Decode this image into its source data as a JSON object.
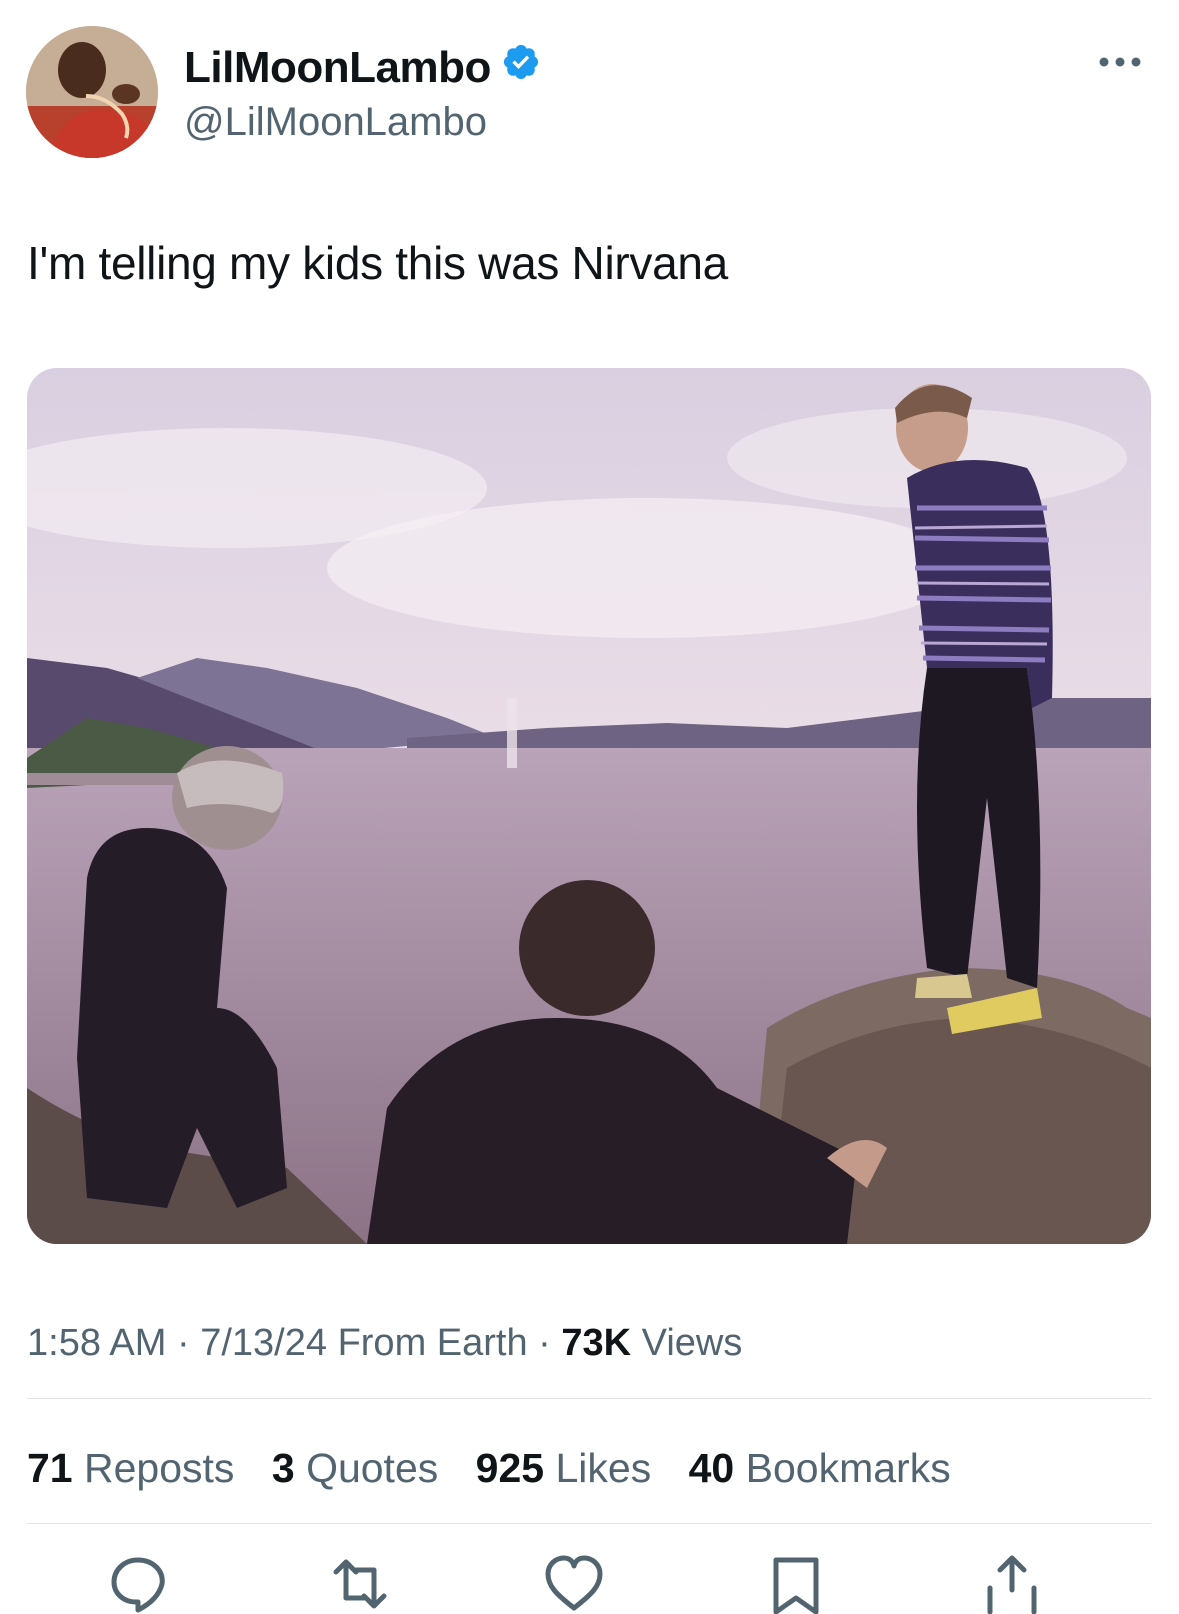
{
  "tweet": {
    "author": {
      "display_name": "LilMoonLambo",
      "handle": "@LilMoonLambo",
      "verified": true,
      "verified_color": "#1d9bf0"
    },
    "text": "I'm telling my kids this was Nirvana",
    "meta": {
      "time": "1:58 AM",
      "separator": "·",
      "date": "7/13/24",
      "source": "From Earth",
      "views_count": "73K",
      "views_label": "Views"
    },
    "stats": [
      {
        "count": "71",
        "label": "Reposts"
      },
      {
        "count": "3",
        "label": "Quotes"
      },
      {
        "count": "925",
        "label": "Likes"
      },
      {
        "count": "40",
        "label": "Bookmarks"
      }
    ],
    "actions": [
      "reply-icon",
      "repost-icon",
      "like-icon",
      "bookmark-icon",
      "share-icon"
    ]
  },
  "colors": {
    "text_primary": "#0f1419",
    "text_secondary": "#536471",
    "accent": "#1d9bf0"
  }
}
